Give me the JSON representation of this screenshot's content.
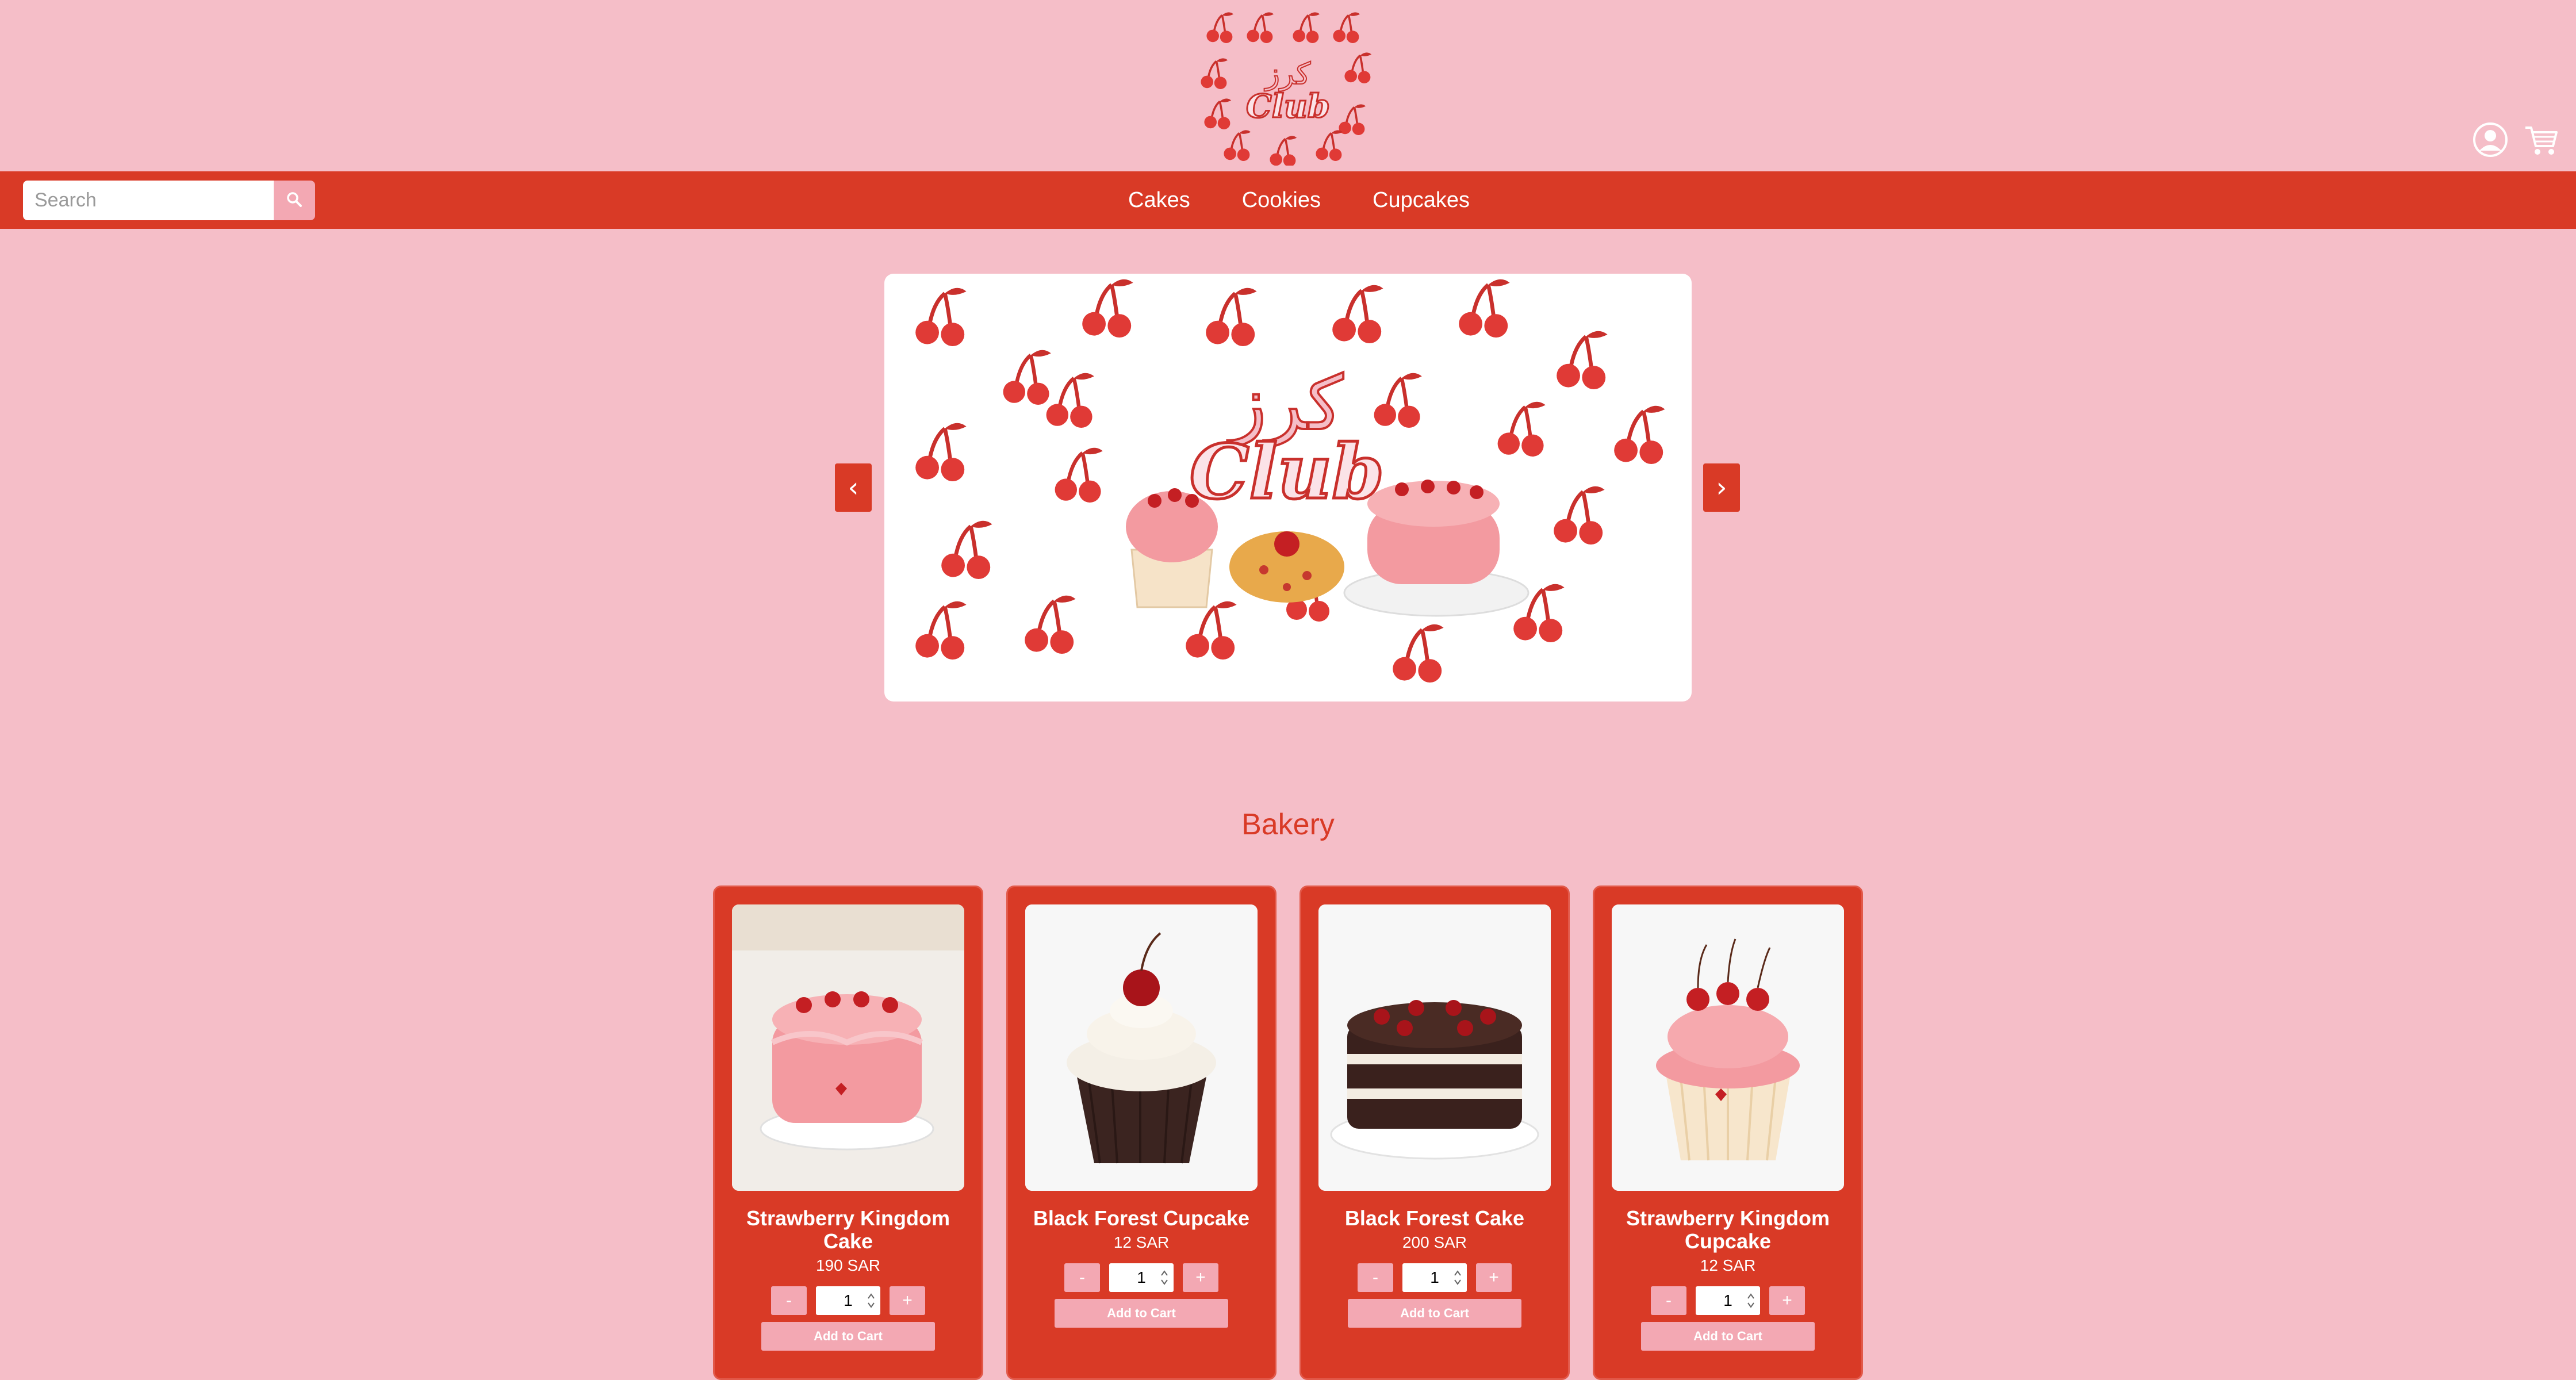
{
  "brand": {
    "logo_text_arabic": "كرز",
    "logo_text_latin": "Club"
  },
  "header": {
    "icons": [
      "user-icon",
      "cart-icon"
    ]
  },
  "search": {
    "placeholder": "Search",
    "icon": "search-icon"
  },
  "nav": {
    "items": [
      {
        "label": "Cakes"
      },
      {
        "label": "Cookies"
      },
      {
        "label": "Cupcakes"
      }
    ]
  },
  "carousel": {
    "prev_label": "‹",
    "next_label": "›"
  },
  "section": {
    "title": "Bakery"
  },
  "products": [
    {
      "name": "Strawberry Kingdom Cake",
      "price": "190 SAR",
      "qty": "1",
      "minus": "-",
      "plus": "+",
      "add_label": "Add to Cart"
    },
    {
      "name": "Black Forest Cupcake",
      "price": "12 SAR",
      "qty": "1",
      "minus": "-",
      "plus": "+",
      "add_label": "Add to Cart"
    },
    {
      "name": "Black Forest Cake",
      "price": "200 SAR",
      "qty": "1",
      "minus": "-",
      "plus": "+",
      "add_label": "Add to Cart"
    },
    {
      "name": "Strawberry Kingdom Cupcake",
      "price": "12 SAR",
      "qty": "1",
      "minus": "-",
      "plus": "+",
      "add_label": "Add to Cart"
    }
  ],
  "colors": {
    "background": "#f5bec8",
    "primary_red": "#d93a26",
    "soft_pink": "#f3a8b3",
    "white": "#ffffff"
  }
}
